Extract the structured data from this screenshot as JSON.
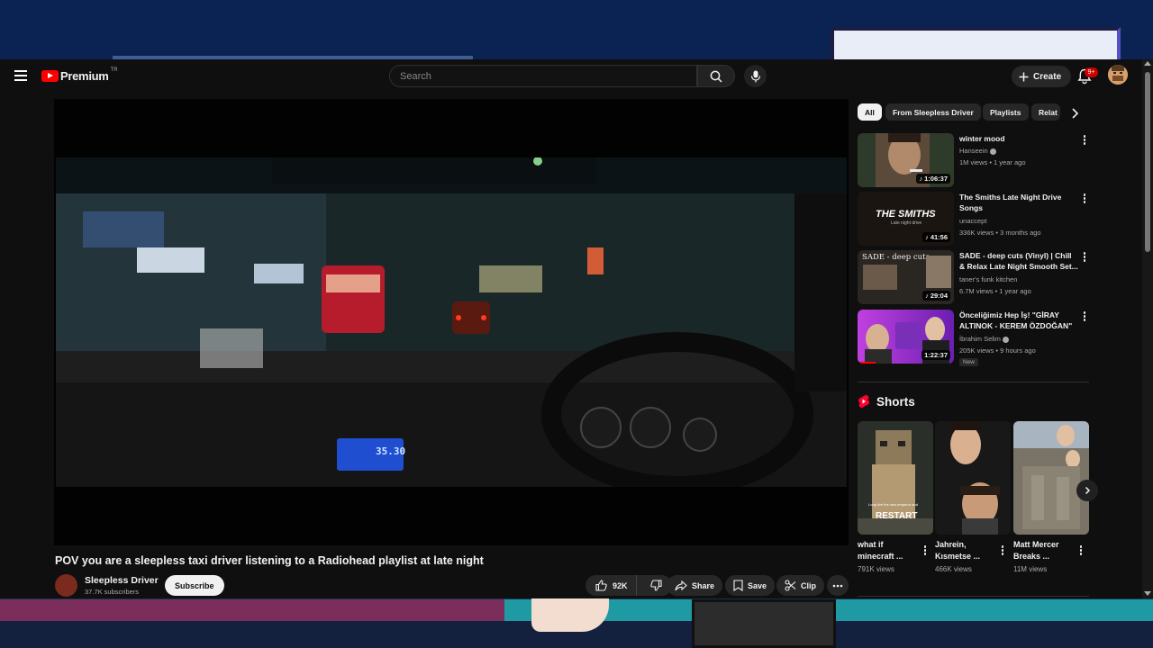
{
  "header": {
    "logo_text": "Premium",
    "logo_region": "TR",
    "search_placeholder": "Search",
    "create_label": "Create",
    "notification_badge": "9+"
  },
  "video": {
    "title": "POV you are a sleepless taxi driver listening to a Radiohead playlist at late night",
    "meter_display": "35.30",
    "channel": {
      "name": "Sleepless Driver",
      "subscribers": "37.7K subscribers",
      "subscribe_label": "Subscribe"
    },
    "actions": {
      "likes": "92K",
      "share": "Share",
      "save": "Save",
      "clip": "Clip"
    }
  },
  "sidebar": {
    "chips": [
      "All",
      "From Sleepless Driver",
      "Playlists",
      "Relat"
    ],
    "related": [
      {
        "title": "winter mood",
        "channel": "Hanseein",
        "verified": true,
        "meta": "1M views • 1 year ago",
        "duration": "1:06:37",
        "new": ""
      },
      {
        "title": "The Smiths Late Night Drive Songs",
        "channel": "unaccept",
        "verified": false,
        "meta": "336K views • 3 months ago",
        "duration": "41:56",
        "thumb_text": "THE SMITHS",
        "thumb_sub": "Late night drive",
        "new": ""
      },
      {
        "title": "SADE - deep cuts (Vinyl) | Chill & Relax Late Night Smooth Set...",
        "channel": "taner's funk kitchen",
        "verified": false,
        "meta": "6.7M views • 1 year ago",
        "duration": "29:04",
        "thumb_text": "SADE - deep cuts",
        "new": ""
      },
      {
        "title": "Önceliğimiz Hep İş! \"GİRAY ALTINOK - KEREM ÖZDOĞAN\" ...",
        "channel": "İbrahim Selim",
        "verified": true,
        "meta": "205K views • 9 hours ago",
        "duration": "1:22:37",
        "new": "New"
      }
    ],
    "shorts_title": "Shorts",
    "shorts": [
      {
        "title": "what if minecraft ...",
        "views": "791K views",
        "overlay": "RESTART",
        "caption": "Long live the new emperor and"
      },
      {
        "title": "Jahrein, Kısmetse ...",
        "views": "466K views"
      },
      {
        "title": "Matt Mercer Breaks ...",
        "views": "11M views"
      }
    ]
  }
}
